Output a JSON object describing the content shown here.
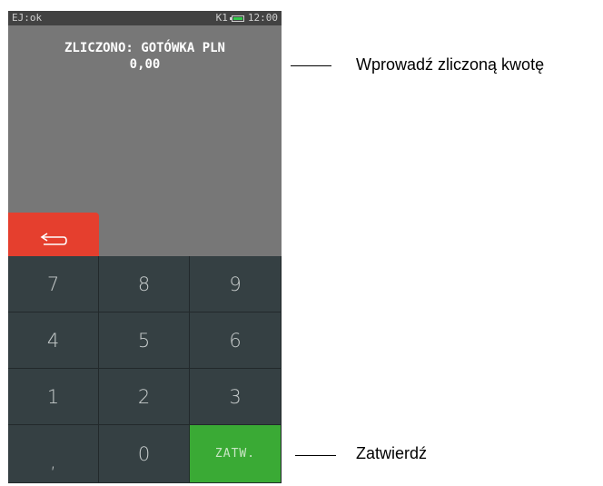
{
  "statusbar": {
    "left_text": "EJ:ok",
    "mode": "K1",
    "time": "12:00"
  },
  "display": {
    "title": "ZLICZONO: GOTÓWKA PLN",
    "value": "0,00"
  },
  "back_button": {
    "icon": "return-arrow-icon",
    "color": "#e53f2e"
  },
  "keypad": {
    "keys": [
      "7",
      "8",
      "9",
      "4",
      "5",
      "6",
      "1",
      "2",
      "3",
      ",",
      "0",
      "ZATW."
    ],
    "confirm_color": "#3aaa35"
  },
  "callouts": {
    "amount": "Wprowadź zliczoną kwotę",
    "confirm": "Zatwierdź"
  }
}
